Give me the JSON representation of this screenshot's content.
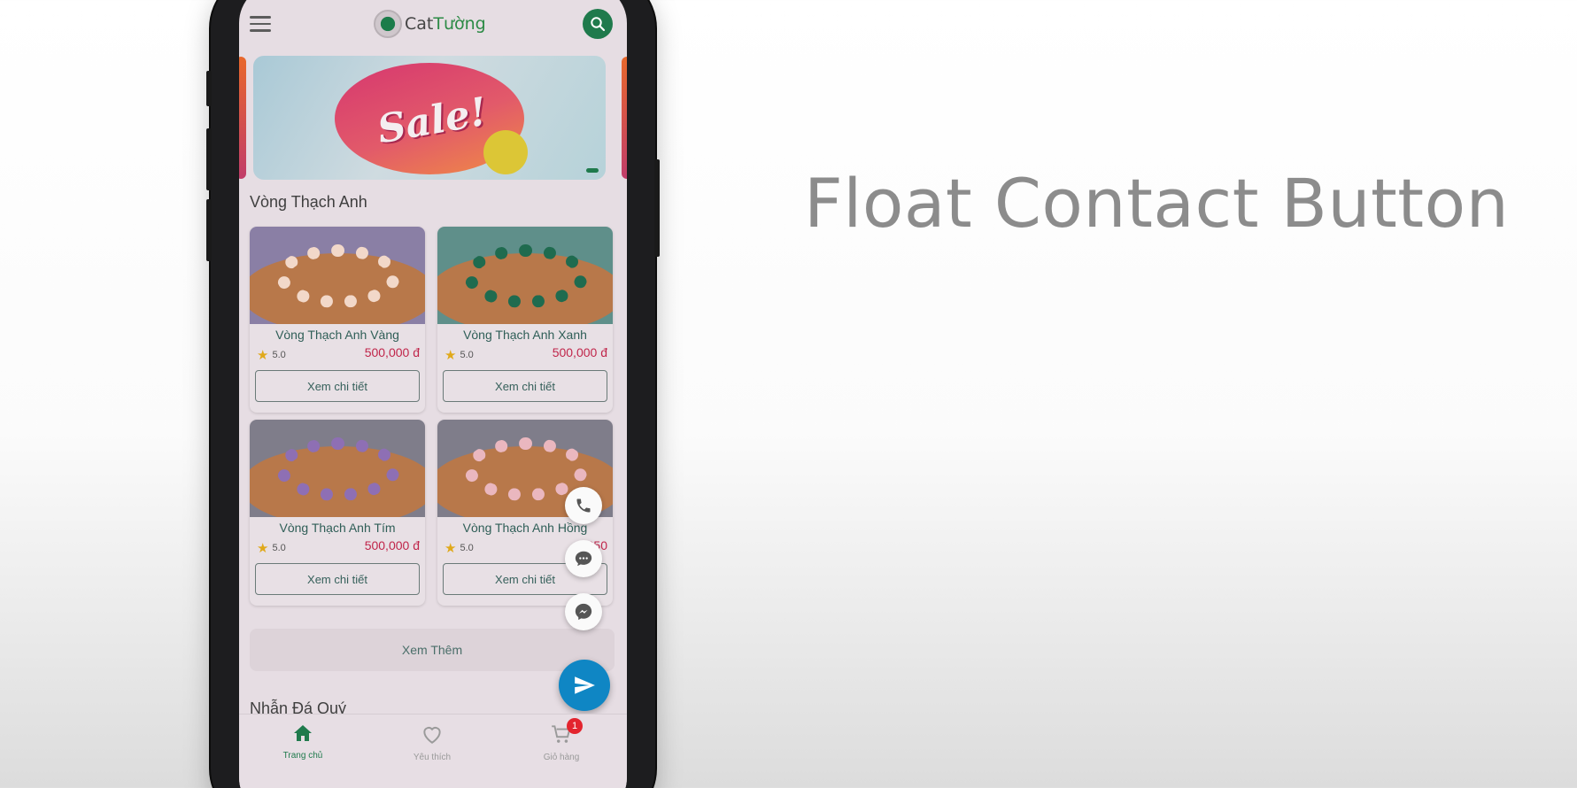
{
  "promo": {
    "title": "Float Contact Button"
  },
  "app": {
    "logo_text_a": "Cat",
    "logo_text_b": "Tường"
  },
  "banner": {
    "text": "Sale!"
  },
  "section1": {
    "title": "Vòng Thạch Anh",
    "products": [
      {
        "name": "Vòng Thạch Anh Vàng",
        "rating": "5.0",
        "price": "500,000 đ",
        "button": "Xem chi tiết",
        "bead_color": "#f2d8c9",
        "bg": "#8a7fa5"
      },
      {
        "name": "Vòng Thạch Anh Xanh",
        "rating": "5.0",
        "price": "500,000 đ",
        "button": "Xem chi tiết",
        "bead_color": "#1f6b4f",
        "bg": "#5f8f8a"
      },
      {
        "name": "Vòng Thạch Anh Tím",
        "rating": "5.0",
        "price": "500,000 đ",
        "button": "Xem chi tiết",
        "bead_color": "#8e6fb4",
        "bg": "#7f7d8a"
      },
      {
        "name": "Vòng Thạch Anh Hồng",
        "rating": "5.0",
        "price": "650",
        "button": "Xem chi tiết",
        "bead_color": "#eab7bf",
        "bg": "#7f7d8a"
      }
    ],
    "more_button": "Xem Thêm"
  },
  "section2": {
    "title": "Nhẫn Đá Quý"
  },
  "nav": {
    "home": "Trang chủ",
    "favorites": "Yêu thích",
    "cart": "Giỏ hàng",
    "cart_badge": "1"
  },
  "colors": {
    "brand_green": "#1f7a4c",
    "fab_blue": "#0f86c4",
    "price_red": "#c0254a"
  }
}
